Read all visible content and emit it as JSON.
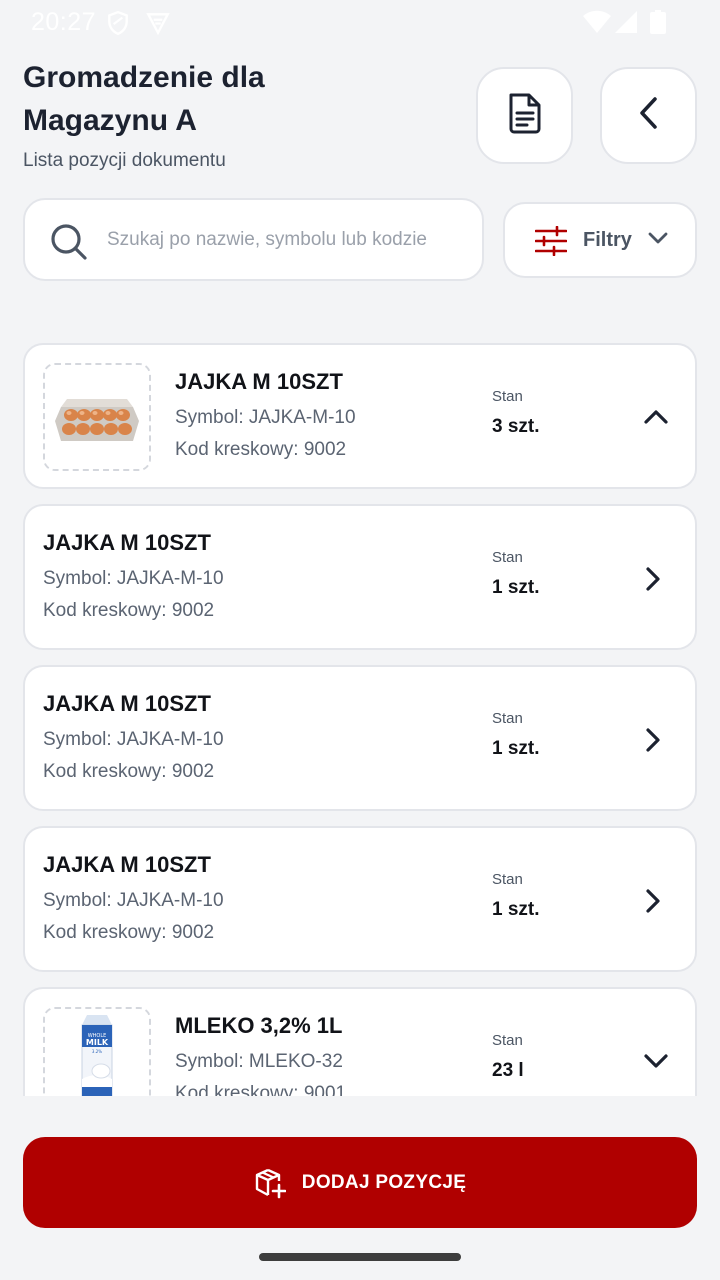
{
  "status_bar": {
    "time": "20:27"
  },
  "header": {
    "title_line1": "Gromadzenie dla",
    "title_line2": "Magazynu A",
    "subtitle": "Lista pozycji dokumentu"
  },
  "search": {
    "placeholder": "Szukaj po nazwie, symbolu lub kodzie",
    "value": ""
  },
  "filters": {
    "label": "Filtry"
  },
  "items": [
    {
      "name": "JAJKA M 10SZT",
      "symbol": "Symbol: JAJKA-M-10",
      "barcode": "Kod kreskowy: 9002",
      "stan_label": "Stan",
      "stan_value": "3 szt.",
      "has_image": true,
      "image": "egg-carton",
      "state": "expanded"
    },
    {
      "name": "JAJKA M 10SZT",
      "symbol": "Symbol: JAJKA-M-10",
      "barcode": "Kod kreskowy: 9002",
      "stan_label": "Stan",
      "stan_value": "1 szt.",
      "has_image": false,
      "state": "navigate"
    },
    {
      "name": "JAJKA M 10SZT",
      "symbol": "Symbol: JAJKA-M-10",
      "barcode": "Kod kreskowy: 9002",
      "stan_label": "Stan",
      "stan_value": "1 szt.",
      "has_image": false,
      "state": "navigate"
    },
    {
      "name": "JAJKA M 10SZT",
      "symbol": "Symbol: JAJKA-M-10",
      "barcode": "Kod kreskowy: 9002",
      "stan_label": "Stan",
      "stan_value": "1 szt.",
      "has_image": false,
      "state": "navigate"
    },
    {
      "name": "MLEKO 3,2% 1L",
      "symbol": "Symbol: MLEKO-32",
      "barcode": "Kod kreskowy: 9001",
      "stan_label": "Stan",
      "stan_value": "23 l",
      "has_image": true,
      "image": "milk-carton",
      "image_text": "WHOLE MILK 3.2%",
      "state": "collapsed"
    }
  ],
  "add_button": {
    "label": "DODAJ POZYCJĘ"
  },
  "colors": {
    "accent": "#b00000",
    "text_primary": "#111318",
    "text_secondary": "#5b6472",
    "border": "#e3e5ea",
    "background": "#f3f4f6"
  }
}
